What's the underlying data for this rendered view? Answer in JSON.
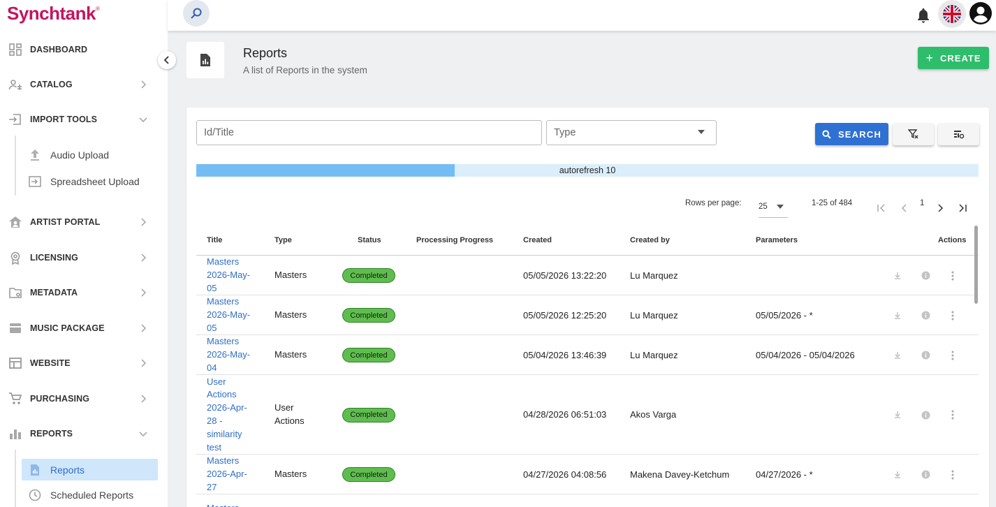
{
  "app": {
    "logo": "Synchtank",
    "logo_mark": "®"
  },
  "sidebar": {
    "items": [
      {
        "label": "DASHBOARD",
        "icon": "dashboard-icon"
      },
      {
        "label": "CATALOG",
        "icon": "catalog-icon"
      },
      {
        "label": "IMPORT TOOLS",
        "icon": "import-icon",
        "expanded": true,
        "children": [
          {
            "label": "Audio Upload",
            "icon": "upload-icon"
          },
          {
            "label": "Spreadsheet Upload",
            "icon": "spreadsheet-import-icon"
          }
        ]
      },
      {
        "label": "ARTIST PORTAL",
        "icon": "artist-portal-icon"
      },
      {
        "label": "LICENSING",
        "icon": "licensing-icon"
      },
      {
        "label": "METADATA",
        "icon": "metadata-icon"
      },
      {
        "label": "MUSIC PACKAGE",
        "icon": "music-package-icon"
      },
      {
        "label": "WEBSITE",
        "icon": "website-icon"
      },
      {
        "label": "PURCHASING",
        "icon": "cart-icon"
      },
      {
        "label": "REPORTS",
        "icon": "reports-icon",
        "expanded": true,
        "children": [
          {
            "label": "Reports",
            "icon": "report-file-icon",
            "active": true
          },
          {
            "label": "Scheduled Reports",
            "icon": "clock-icon"
          }
        ]
      }
    ]
  },
  "header": {
    "title": "Reports",
    "subtitle": "A list of Reports in the system",
    "create_label": "CREATE"
  },
  "filters": {
    "id_title_placeholder": "Id/Title",
    "type_placeholder": "Type",
    "search_label": "SEARCH"
  },
  "autorefresh": {
    "label": "autorefresh 10",
    "progress": 0.33
  },
  "pagination": {
    "rows_per_page_label": "Rows per page:",
    "rows_per_page": "25",
    "range": "1-25 of 484",
    "page": "1"
  },
  "table": {
    "columns": [
      "Title",
      "Type",
      "Status",
      "Processing Progress",
      "Created",
      "Created by",
      "Parameters",
      "Actions"
    ],
    "rows": [
      {
        "title": [
          "Masters",
          "2026-May-",
          "05"
        ],
        "type": [
          "Masters"
        ],
        "status": "Completed",
        "progress": "",
        "created": "05/05/2026 13:22:20",
        "created_by": "Lu Marquez",
        "parameters": ""
      },
      {
        "title": [
          "Masters",
          "2026-May-",
          "05"
        ],
        "type": [
          "Masters"
        ],
        "status": "Completed",
        "progress": "",
        "created": "05/05/2026 12:25:20",
        "created_by": "Lu Marquez",
        "parameters": "05/05/2026 - *"
      },
      {
        "title": [
          "Masters",
          "2026-May-",
          "04"
        ],
        "type": [
          "Masters"
        ],
        "status": "Completed",
        "progress": "",
        "created": "05/04/2026 13:46:39",
        "created_by": "Lu Marquez",
        "parameters": "05/04/2026 - 05/04/2026"
      },
      {
        "title": [
          "User",
          "Actions",
          "2026-Apr-",
          "28 -",
          "similarity",
          "test"
        ],
        "type": [
          "User",
          "Actions"
        ],
        "status": "Completed",
        "progress": "",
        "created": "04/28/2026 06:51:03",
        "created_by": "Akos Varga",
        "parameters": ""
      },
      {
        "title": [
          "Masters",
          "2026-Apr-",
          "27"
        ],
        "type": [
          "Masters"
        ],
        "status": "Completed",
        "progress": "",
        "created": "04/27/2026 04:08:56",
        "created_by": "Makena Davey-Ketchum",
        "parameters": "04/27/2026 - *"
      },
      {
        "title": [
          "Masters"
        ],
        "type": [],
        "status": "",
        "progress": "",
        "created": "",
        "created_by": "",
        "parameters": ""
      }
    ]
  },
  "colors": {
    "brand": "#c3155f",
    "primary": "#2f71d3",
    "create": "#2ebd6b",
    "badge": "#5ebe4d",
    "link": "#2f6ec7"
  }
}
